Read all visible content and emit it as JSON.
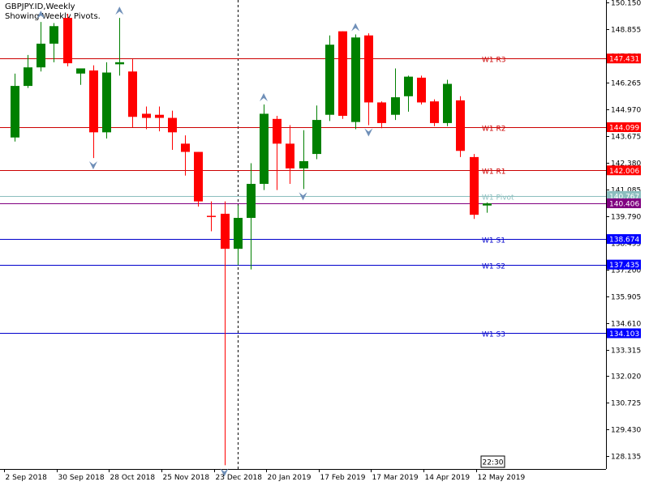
{
  "header": {
    "symbol_line": "GBPJPY.ID,Weekly",
    "info_line": "Showing Weekly Pivots."
  },
  "time_badge": "22:30",
  "chart_data": {
    "type": "candlestick",
    "symbol": "GBPJPY.ID",
    "timeframe": "Weekly",
    "ylim": [
      127.52,
      150.15
    ],
    "y_ticks": [
      "150.150",
      "148.855",
      "147.560",
      "146.265",
      "144.970",
      "143.675",
      "142.380",
      "141.085",
      "139.790",
      "138.495",
      "137.200",
      "135.905",
      "134.610",
      "133.315",
      "132.020",
      "130.725",
      "129.430",
      "128.135"
    ],
    "x_tick_labels": [
      {
        "label": "2 Sep 2018",
        "index": 0
      },
      {
        "label": "30 Sep 2018",
        "index": 4
      },
      {
        "label": "28 Oct 2018",
        "index": 8
      },
      {
        "label": "25 Nov 2018",
        "index": 12
      },
      {
        "label": "23 Dec 2018",
        "index": 16
      },
      {
        "label": "20 Jan 2019",
        "index": 20
      },
      {
        "label": "17 Feb 2019",
        "index": 24
      },
      {
        "label": "17 Mar 2019",
        "index": 28
      },
      {
        "label": "14 Apr 2019",
        "index": 32
      },
      {
        "label": "12 May 2019",
        "index": 36
      }
    ],
    "colors": {
      "bull": "#008000",
      "bear": "#ff0000",
      "doji": "#ff0000"
    },
    "candles": [
      {
        "o": 143.6,
        "h": 146.7,
        "l": 143.4,
        "c": 146.1
      },
      {
        "o": 146.1,
        "h": 147.6,
        "l": 146.0,
        "c": 147.0
      },
      {
        "o": 147.0,
        "h": 149.2,
        "l": 146.8,
        "c": 148.15
      },
      {
        "o": 148.15,
        "h": 149.15,
        "l": 147.25,
        "c": 149.0
      },
      {
        "o": 149.4,
        "h": 149.6,
        "l": 147.05,
        "c": 147.2
      },
      {
        "o": 146.7,
        "h": 146.85,
        "l": 146.15,
        "c": 146.95
      },
      {
        "o": 146.85,
        "h": 147.1,
        "l": 142.6,
        "c": 143.85
      },
      {
        "o": 143.85,
        "h": 147.25,
        "l": 143.55,
        "c": 146.75
      },
      {
        "o": 147.15,
        "h": 149.4,
        "l": 146.6,
        "c": 147.25
      },
      {
        "o": 146.8,
        "h": 147.4,
        "l": 144.1,
        "c": 144.6
      },
      {
        "o": 144.75,
        "h": 145.1,
        "l": 144.0,
        "c": 144.55
      },
      {
        "o": 144.7,
        "h": 145.1,
        "l": 143.9,
        "c": 144.55
      },
      {
        "o": 144.55,
        "h": 144.9,
        "l": 143.0,
        "c": 143.85
      },
      {
        "o": 143.3,
        "h": 143.7,
        "l": 141.75,
        "c": 142.9
      },
      {
        "o": 142.9,
        "h": 142.9,
        "l": 140.25,
        "c": 140.5
      },
      {
        "o": 139.8,
        "h": 140.5,
        "l": 139.05,
        "c": 139.75
      },
      {
        "o": 139.9,
        "h": 140.5,
        "l": 127.7,
        "c": 138.2
      },
      {
        "o": 138.2,
        "h": 140.3,
        "l": 137.4,
        "c": 139.7
      },
      {
        "o": 139.7,
        "h": 142.35,
        "l": 137.2,
        "c": 141.35
      },
      {
        "o": 141.35,
        "h": 145.2,
        "l": 141.05,
        "c": 144.75
      },
      {
        "o": 144.5,
        "h": 144.65,
        "l": 141.05,
        "c": 143.3
      },
      {
        "o": 143.3,
        "h": 144.2,
        "l": 141.35,
        "c": 142.1
      },
      {
        "o": 142.1,
        "h": 143.95,
        "l": 141.1,
        "c": 142.45
      },
      {
        "o": 142.8,
        "h": 145.15,
        "l": 142.55,
        "c": 144.45
      },
      {
        "o": 144.7,
        "h": 148.55,
        "l": 144.4,
        "c": 148.1
      },
      {
        "o": 148.75,
        "h": 148.75,
        "l": 144.5,
        "c": 144.65
      },
      {
        "o": 144.35,
        "h": 148.6,
        "l": 144.0,
        "c": 148.45
      },
      {
        "o": 148.55,
        "h": 148.65,
        "l": 144.2,
        "c": 145.3
      },
      {
        "o": 145.3,
        "h": 145.35,
        "l": 144.05,
        "c": 144.3
      },
      {
        "o": 144.7,
        "h": 146.95,
        "l": 144.45,
        "c": 145.55
      },
      {
        "o": 145.6,
        "h": 146.6,
        "l": 144.85,
        "c": 146.55
      },
      {
        "o": 146.5,
        "h": 146.6,
        "l": 145.2,
        "c": 145.3
      },
      {
        "o": 145.35,
        "h": 145.45,
        "l": 144.15,
        "c": 144.3
      },
      {
        "o": 144.3,
        "h": 146.4,
        "l": 144.15,
        "c": 146.2
      },
      {
        "o": 145.4,
        "h": 145.6,
        "l": 142.65,
        "c": 142.95
      },
      {
        "o": 142.65,
        "h": 142.8,
        "l": 139.65,
        "c": 139.85
      },
      {
        "o": 140.3,
        "h": 140.45,
        "l": 139.95,
        "c": 140.4
      }
    ],
    "pivot_levels": [
      {
        "name": "W1 R3",
        "value": 147.431,
        "label": "147.431",
        "color": "#cc0000",
        "tag": "#ff0000"
      },
      {
        "name": "W1 R2",
        "value": 144.099,
        "label": "144.099",
        "color": "#cc0000",
        "tag": "#ff0000"
      },
      {
        "name": "W1 R1",
        "value": 142.006,
        "label": "142.006",
        "color": "#cc0000",
        "tag": "#ff0000"
      },
      {
        "name": "W1 Pivot",
        "value": 140.767,
        "label": "140.767",
        "color": "#8cbfbf",
        "tag": "#8cbfbf"
      },
      {
        "name": "W1 S1",
        "value": 138.674,
        "label": "138.674",
        "color": "#0000cc",
        "tag": "#0000ff"
      },
      {
        "name": "W1 S2",
        "value": 137.435,
        "label": "137.435",
        "color": "#0000cc",
        "tag": "#0000ff"
      },
      {
        "name": "W1 S3",
        "value": 134.103,
        "label": "134.103",
        "color": "#0000cc",
        "tag": "#0000ff"
      }
    ],
    "current_price": {
      "value": 140.406,
      "label": "140.406",
      "color": "#800080"
    },
    "fractals_up": [
      2,
      8,
      19,
      26
    ],
    "fractals_down": [
      6,
      16,
      22,
      27
    ],
    "period_separator_index": 17
  }
}
